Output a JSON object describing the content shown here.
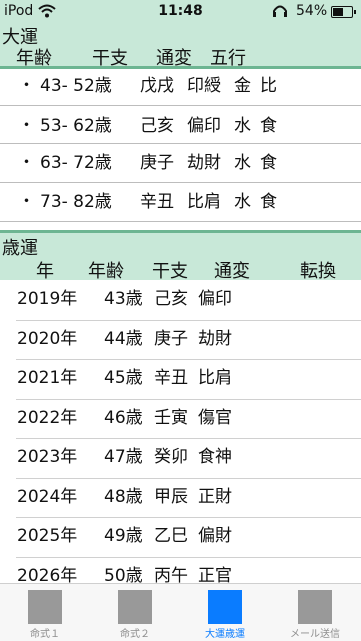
{
  "status_bar": {
    "carrier": "iPod",
    "time": "11:48",
    "battery": "54%",
    "battery_level": 0.54,
    "icons": [
      "wifi-icon",
      "headphones-icon",
      "battery-icon"
    ]
  },
  "daiun": {
    "title": "大運",
    "headers": {
      "age": "年齢",
      "kanshi": "干支",
      "tsuhen": "通変",
      "gogyo": "五行"
    },
    "rows": [
      {
        "bullet": "・",
        "age": "43- 52歳",
        "kanshi": "戊戌",
        "tsuhen": "印綬",
        "element": "金",
        "relation": "比"
      },
      {
        "bullet": "・",
        "age": "53- 62歳",
        "kanshi": "己亥",
        "tsuhen": "偏印",
        "element": "水",
        "relation": "食"
      },
      {
        "bullet": "・",
        "age": "63- 72歳",
        "kanshi": "庚子",
        "tsuhen": "劫財",
        "element": "水",
        "relation": "食"
      },
      {
        "bullet": "・",
        "age": "73- 82歳",
        "kanshi": "辛丑",
        "tsuhen": "比肩",
        "element": "水",
        "relation": "食"
      }
    ]
  },
  "saiun": {
    "title": "歳運",
    "headers": {
      "year": "年",
      "age": "年齢",
      "kanshi": "干支",
      "tsuhen": "通変",
      "tenkan": "転換"
    },
    "rows": [
      {
        "year": "2019年",
        "age": "43歳",
        "kanshi": "己亥",
        "tsuhen": "偏印"
      },
      {
        "year": "2020年",
        "age": "44歳",
        "kanshi": "庚子",
        "tsuhen": "劫財"
      },
      {
        "year": "2021年",
        "age": "45歳",
        "kanshi": "辛丑",
        "tsuhen": "比肩"
      },
      {
        "year": "2022年",
        "age": "46歳",
        "kanshi": "壬寅",
        "tsuhen": "傷官"
      },
      {
        "year": "2023年",
        "age": "47歳",
        "kanshi": "癸卯",
        "tsuhen": "食神"
      },
      {
        "year": "2024年",
        "age": "48歳",
        "kanshi": "甲辰",
        "tsuhen": "正財"
      },
      {
        "year": "2025年",
        "age": "49歳",
        "kanshi": "乙巳",
        "tsuhen": "偏財"
      },
      {
        "year": "2026年",
        "age": "50歳",
        "kanshi": "丙午",
        "tsuhen": "正官"
      }
    ]
  },
  "tab_bar": {
    "active_index": 2,
    "tabs": [
      {
        "label": "命式１"
      },
      {
        "label": "命式２"
      },
      {
        "label": "大運歳運"
      },
      {
        "label": "メール送信"
      }
    ]
  },
  "colors": {
    "header_bg": "#c8e8d8",
    "rule": "#6db592",
    "accent": "#0a7cff",
    "inactive": "#999999"
  }
}
